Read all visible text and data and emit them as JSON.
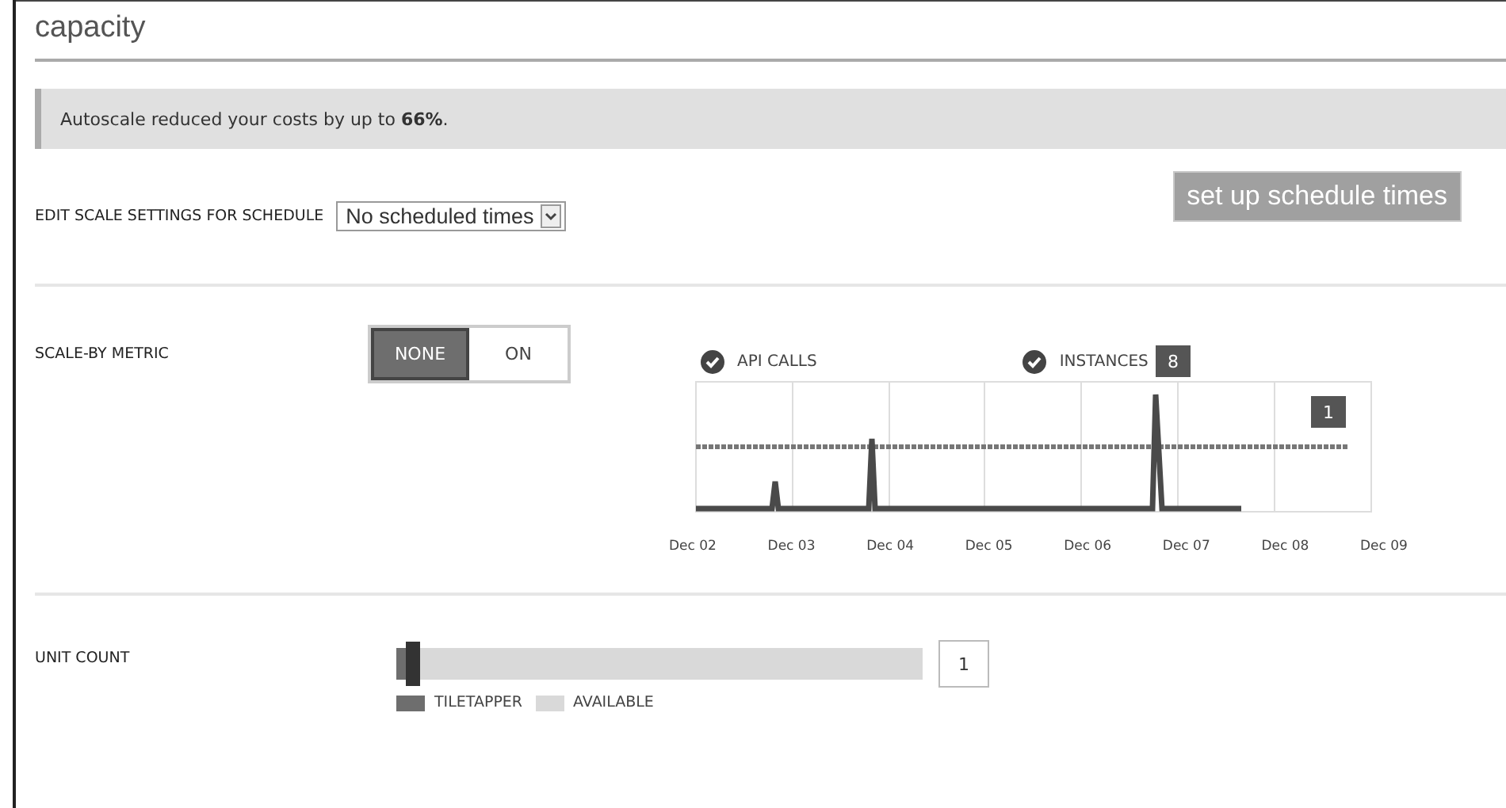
{
  "title": "capacity",
  "banner": {
    "text": "Autoscale reduced your costs by up to **66%**."
  },
  "schedule": {
    "label": "EDIT SCALE SETTINGS FOR SCHEDULE",
    "value": "No scheduled times",
    "button": "set up schedule times"
  },
  "scale_by_metric": {
    "label": "SCALE-BY METRIC",
    "options": [
      {
        "label": "NONE",
        "selected": true
      },
      {
        "label": "ON",
        "selected": false
      }
    ]
  },
  "chart": {
    "legend": [
      {
        "label": "API CALLS",
        "checked": true
      },
      {
        "label": "INSTANCES",
        "checked": true
      }
    ],
    "callouts": [
      "8",
      "1"
    ],
    "x_labels": [
      "Dec 02",
      "Dec 03",
      "Dec 04",
      "Dec 05",
      "Dec 06",
      "Dec 07",
      "Dec 08",
      "Dec 09"
    ]
  },
  "unit_count": {
    "label": "UNIT COUNT",
    "level": 0.03,
    "value": "1",
    "legend": [
      {
        "label": "TILETAPPER",
        "color": "#6e6e6e"
      },
      {
        "label": "AVAILABLE",
        "color": "#d9d9d9"
      }
    ]
  }
}
